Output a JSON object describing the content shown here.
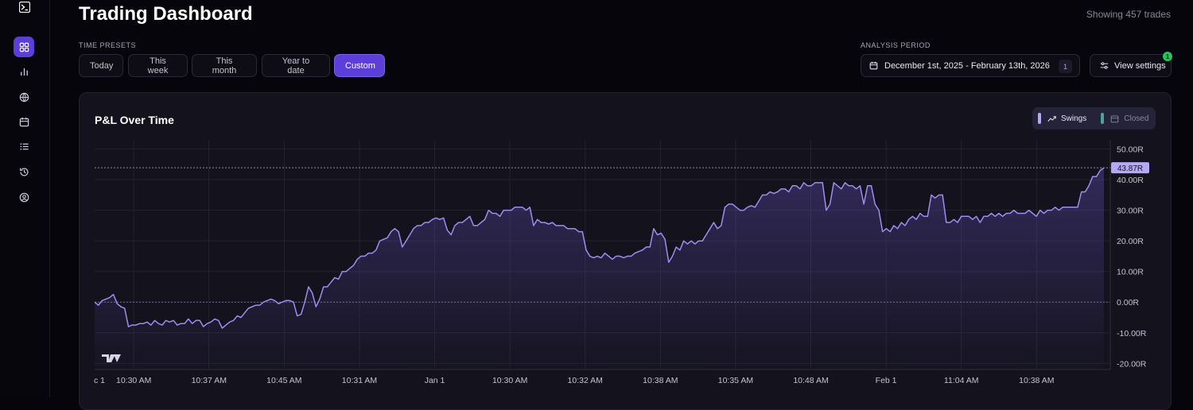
{
  "sidebar": {
    "items": [
      {
        "name": "dashboard",
        "icon": "grid-icon",
        "active": true
      },
      {
        "name": "analytics",
        "icon": "bar-chart-icon"
      },
      {
        "name": "markets",
        "icon": "globe-icon"
      },
      {
        "name": "calendar",
        "icon": "calendar-icon"
      },
      {
        "name": "trades",
        "icon": "list-icon"
      },
      {
        "name": "history",
        "icon": "history-icon"
      },
      {
        "name": "profile",
        "icon": "user-circle-icon"
      }
    ]
  },
  "header": {
    "title": "Trading Dashboard",
    "trade_count": "Showing 457 trades"
  },
  "time_presets": {
    "label": "TIME PRESETS",
    "items": [
      "Today",
      "This week",
      "This month",
      "Year to date",
      "Custom"
    ],
    "selected": "Custom"
  },
  "analysis_period": {
    "label": "ANALYSIS PERIOD",
    "value": "December 1st, 2025 - February 13th, 2026",
    "count": "1"
  },
  "settings": {
    "label": "View settings",
    "badge": "1"
  },
  "card": {
    "title": "P&L Over Time",
    "legend": [
      {
        "label": "Swings",
        "color": "#b7a8f5",
        "icon": "trend-up-icon"
      },
      {
        "label": "Closed",
        "color": "#4fa394",
        "icon": "calendar-icon"
      }
    ]
  },
  "colors": {
    "accent": "#5b3fd8",
    "line": "#a08cf0",
    "positive": "#22c55e"
  },
  "chart_data": {
    "type": "area",
    "series": [
      {
        "name": "Swings",
        "values": [
          0,
          -1,
          0.5,
          1,
          1.5,
          2.5,
          -0.5,
          -1.5,
          -2,
          -8,
          -7.5,
          -7.5,
          -7,
          -7,
          -6.5,
          -7.5,
          -6,
          -7,
          -7.5,
          -6,
          -6.5,
          -6,
          -7.5,
          -7,
          -7,
          -5.5,
          -7,
          -6,
          -6,
          -8,
          -7,
          -6.5,
          -5.5,
          -6,
          -8.5,
          -7.5,
          -6.5,
          -6,
          -4.5,
          -5,
          -3.5,
          -2,
          -1.5,
          -1,
          -1,
          0,
          0.5,
          1,
          0.5,
          -0.5,
          0,
          0.5,
          0.5,
          0,
          -4.5,
          -4,
          0,
          5,
          3,
          -1.5,
          1,
          5,
          5,
          6.5,
          8,
          7.5,
          10,
          10,
          11,
          12,
          14,
          15,
          15,
          16,
          16,
          17,
          20,
          20.5,
          21,
          23,
          24,
          23,
          18,
          20,
          22,
          24,
          25,
          25,
          26,
          26,
          27,
          27.5,
          27,
          27.5,
          23.5,
          22,
          25,
          26,
          26,
          27,
          28,
          25,
          25,
          26,
          27,
          30,
          29,
          29,
          28,
          30,
          30,
          30,
          31,
          31,
          31,
          30,
          31,
          25,
          27,
          26,
          26,
          25.5,
          26,
          25,
          25,
          25,
          24,
          24,
          24,
          23,
          23,
          17,
          15,
          14.5,
          15,
          14.5,
          16,
          15,
          14,
          15,
          15,
          14.5,
          15,
          15,
          16,
          16.5,
          17,
          18,
          18,
          24,
          22,
          22.5,
          20.5,
          13,
          15,
          18,
          17,
          20,
          19,
          20,
          19,
          20,
          20,
          22,
          24,
          26,
          24,
          25,
          31,
          32,
          32,
          31,
          30,
          30,
          31,
          31.5,
          31,
          33,
          35,
          35,
          36,
          35.5,
          36,
          37,
          37,
          36,
          38,
          38,
          37,
          39,
          38,
          38,
          39,
          39,
          39,
          30,
          32,
          39,
          38,
          37,
          39,
          38,
          38,
          37,
          38,
          32,
          38,
          38,
          32,
          30,
          23,
          24,
          23,
          25,
          24,
          26,
          25,
          27,
          28,
          27,
          29,
          28,
          28,
          35,
          34,
          35,
          35,
          26,
          26,
          27,
          26,
          28,
          28,
          28,
          27,
          28,
          26,
          28,
          28,
          29,
          28,
          29,
          28,
          29,
          29,
          30,
          29,
          29,
          29,
          30,
          29,
          28,
          30,
          29,
          30,
          30,
          31,
          30,
          31,
          31,
          31,
          31,
          31,
          36,
          36,
          38,
          41,
          41,
          43,
          43.87
        ]
      }
    ],
    "x_labels": [
      "c 1",
      "10:30 AM",
      "10:37 AM",
      "10:45 AM",
      "10:31 AM",
      "Jan 1",
      "10:30 AM",
      "10:32 AM",
      "10:38 AM",
      "10:35 AM",
      "10:48 AM",
      "Feb 1",
      "11:04 AM",
      "10:38 AM"
    ],
    "y_ticks": [
      50,
      40,
      30,
      20,
      10,
      0,
      -10,
      -20
    ],
    "y_tick_labels": [
      "50.00R",
      "40.00R",
      "30.00R",
      "20.00R",
      "10.00R",
      "0.00R",
      "-10.00R",
      "-20.00R"
    ],
    "ylim": [
      -22,
      53
    ],
    "current_value": 43.87,
    "current_label": "43.87R",
    "grid": true
  }
}
